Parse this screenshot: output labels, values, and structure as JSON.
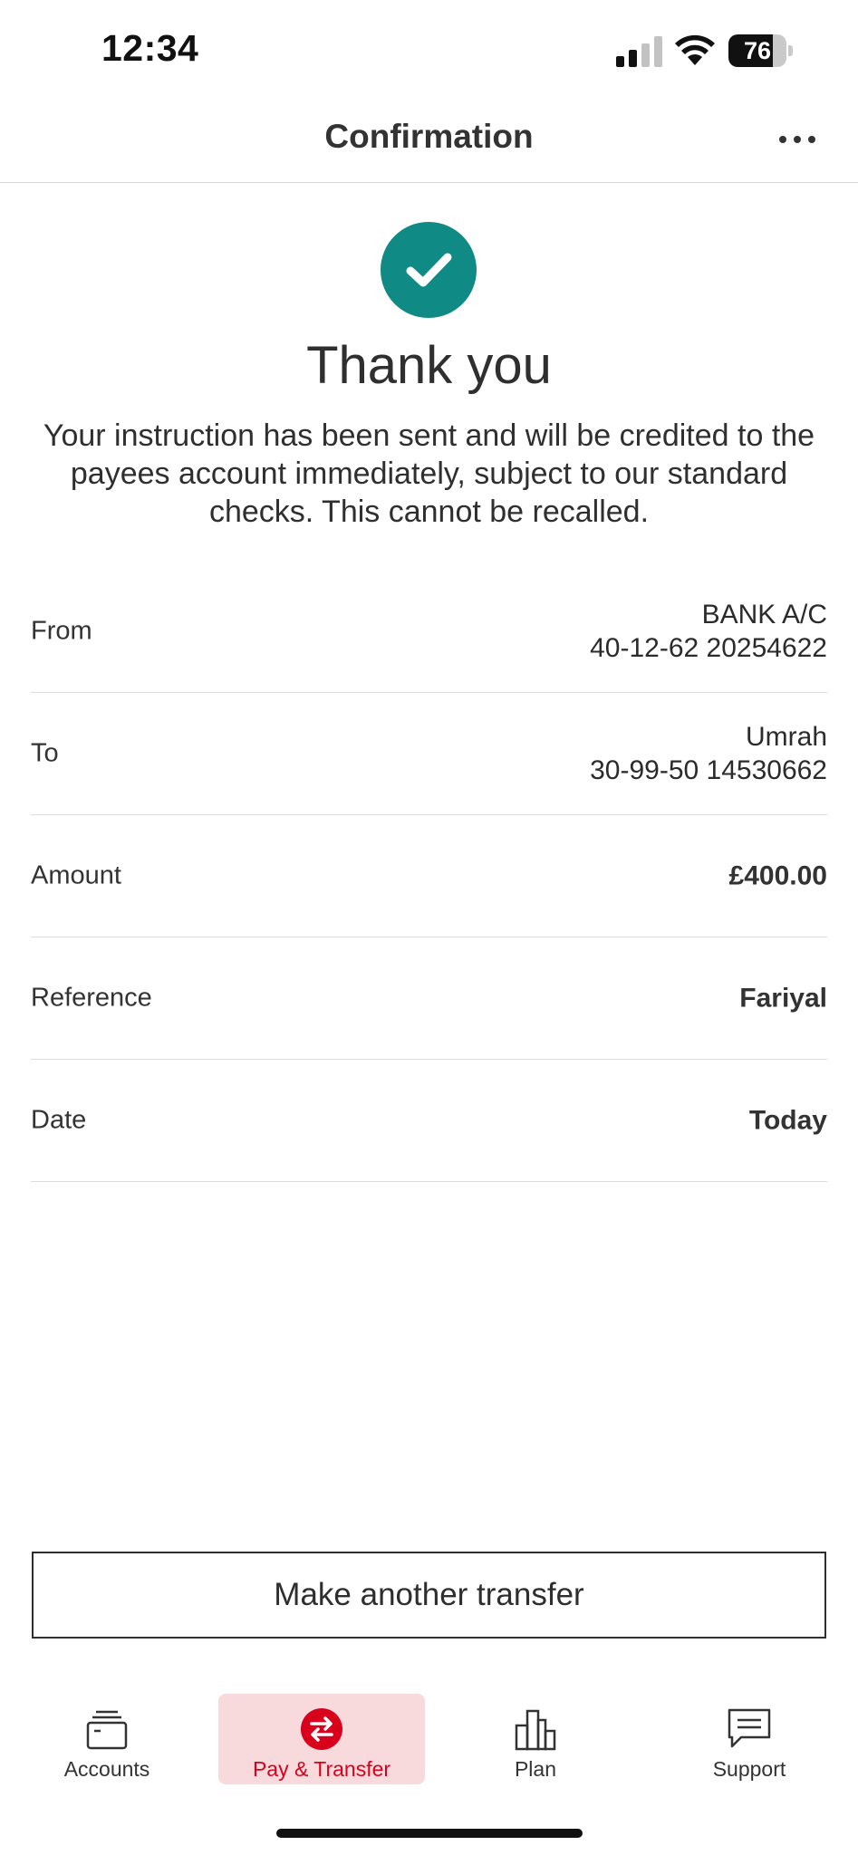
{
  "status_bar": {
    "time": "12:34",
    "battery": "76",
    "battery_level": 0.76
  },
  "header": {
    "title": "Confirmation",
    "more_icon": "ellipsis-icon"
  },
  "confirmation": {
    "icon": "check-circle-icon",
    "title": "Thank you",
    "message": "Your instruction has been sent and will be credited to the payees account immediately, subject to our standard checks.  This cannot be recalled."
  },
  "details": [
    {
      "label": "From",
      "value_line1": "BANK A/C",
      "value_line2": "40-12-62 20254622"
    },
    {
      "label": "To",
      "value_line1": "Umrah",
      "value_line2": "30-99-50 14530662"
    },
    {
      "label": "Amount",
      "value_line1": "£400.00"
    },
    {
      "label": "Reference",
      "value_line1": "Fariyal"
    },
    {
      "label": "Date",
      "value_line1": "Today"
    }
  ],
  "action": {
    "label": "Make another transfer"
  },
  "bottom_nav": {
    "items": [
      {
        "label": "Accounts",
        "icon": "wallet-icon"
      },
      {
        "label": "Pay & Transfer",
        "icon": "transfer-arrows-icon",
        "active": true
      },
      {
        "label": "Plan",
        "icon": "bar-chart-icon"
      },
      {
        "label": "Support",
        "icon": "chat-bubble-icon"
      }
    ]
  },
  "colors": {
    "success_teal": "#108a84",
    "brand_red": "#d9001b",
    "active_nav_bg": "#f8d9dc"
  }
}
